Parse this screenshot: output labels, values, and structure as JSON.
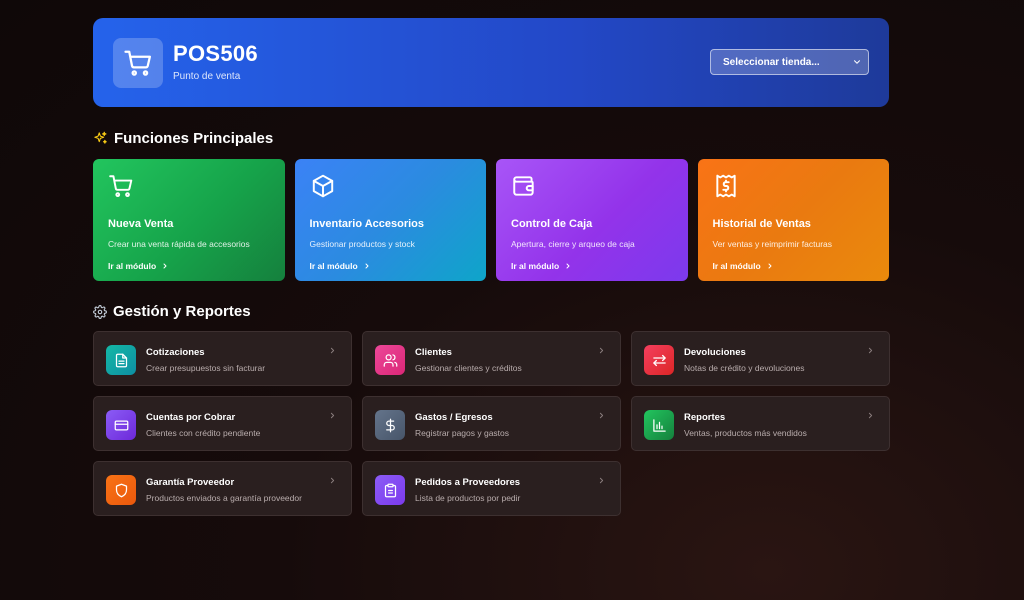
{
  "header": {
    "title": "POS506",
    "subtitle": "Punto de venta",
    "store_select": "Seleccionar tienda...",
    "logo_icon": "shopping-cart-icon"
  },
  "sections": {
    "main_title": "Funciones Principales",
    "reports_title": "Gestión y Reportes"
  },
  "features": [
    {
      "title": "Nueva Venta",
      "desc": "Crear una venta rápida de accesorios",
      "link": "Ir al módulo",
      "icon": "shopping-cart-icon",
      "color": "#22c55e"
    },
    {
      "title": "Inventario Accesorios",
      "desc": "Gestionar productos y stock",
      "link": "Ir al módulo",
      "icon": "box-icon",
      "color": "#3b82f6"
    },
    {
      "title": "Control de Caja",
      "desc": "Apertura, cierre y arqueo de caja",
      "link": "Ir al módulo",
      "icon": "wallet-icon",
      "color": "#a855f7"
    },
    {
      "title": "Historial de Ventas",
      "desc": "Ver ventas y reimprimir facturas",
      "link": "Ir al módulo",
      "icon": "receipt-icon",
      "color": "#f97316"
    }
  ],
  "cards": [
    {
      "title": "Cotizaciones",
      "desc": "Crear presupuestos sin facturar",
      "icon": "document-icon",
      "color": "#14a3a8"
    },
    {
      "title": "Clientes",
      "desc": "Gestionar clientes y créditos",
      "icon": "users-icon",
      "color": "#ec4899"
    },
    {
      "title": "Devoluciones",
      "desc": "Notas de crédito y devoluciones",
      "icon": "swap-arrows-icon",
      "color": "#ef4444"
    },
    {
      "title": "Cuentas por Cobrar",
      "desc": "Clientes con crédito pendiente",
      "icon": "credit-card-icon",
      "color": "#7c3aed"
    },
    {
      "title": "Gastos / Egresos",
      "desc": "Registrar pagos y gastos",
      "icon": "dollar-icon",
      "color": "#64748b"
    },
    {
      "title": "Reportes",
      "desc": "Ventas, productos más vendidos",
      "icon": "bar-chart-icon",
      "color": "#16a34a"
    },
    {
      "title": "Garantía Proveedor",
      "desc": "Productos enviados a garantía proveedor",
      "icon": "shield-icon",
      "color": "#f07a0a"
    },
    {
      "title": "Pedidos a Proveedores",
      "desc": "Lista de productos por pedir",
      "icon": "clipboard-icon",
      "color": "#8b5cf6"
    }
  ]
}
